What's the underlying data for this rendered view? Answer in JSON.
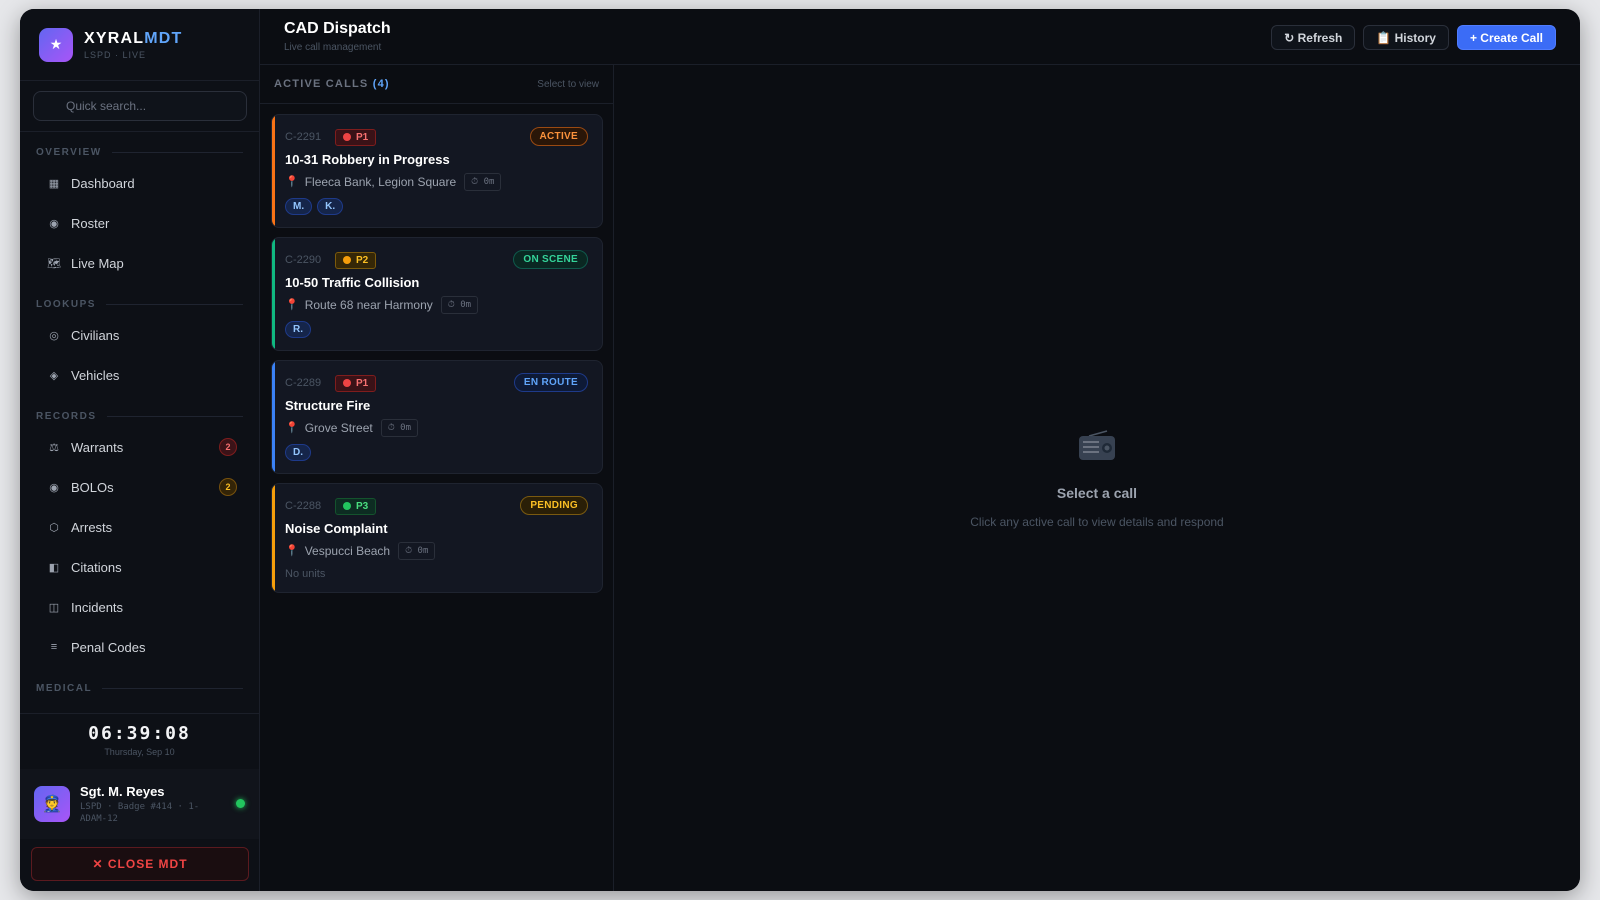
{
  "brand": {
    "name_part1": "XYRAL",
    "name_part2": "MDT",
    "sub": "LSPD · LIVE",
    "logo_icon": "star-icon"
  },
  "search": {
    "placeholder": "Quick search..."
  },
  "sidebar": {
    "sections": [
      {
        "title": "OVERVIEW",
        "items": [
          {
            "label": "Dashboard",
            "icon": "grid-icon"
          },
          {
            "label": "Roster",
            "icon": "target-icon"
          },
          {
            "label": "Live Map",
            "icon": "map-icon"
          }
        ]
      },
      {
        "title": "LOOKUPS",
        "items": [
          {
            "label": "Civilians",
            "icon": "person-icon"
          },
          {
            "label": "Vehicles",
            "icon": "diamond-icon"
          }
        ]
      },
      {
        "title": "RECORDS",
        "items": [
          {
            "label": "Warrants",
            "icon": "scale-icon",
            "badge": "2"
          },
          {
            "label": "BOLOs",
            "icon": "target-icon",
            "badge": "2"
          },
          {
            "label": "Arrests",
            "icon": "hexagon-icon"
          },
          {
            "label": "Citations",
            "icon": "ticket-icon"
          },
          {
            "label": "Incidents",
            "icon": "file-icon"
          },
          {
            "label": "Penal Codes",
            "icon": "list-icon"
          }
        ]
      },
      {
        "title": "MEDICAL",
        "items": []
      }
    ]
  },
  "clock": {
    "time": "06:39:08",
    "date": "Thursday, Sep 10"
  },
  "user": {
    "name": "Sgt. M. Reyes",
    "meta": "LSPD · Badge #414 · 1-ADAM-12",
    "status_color": "#22c55e"
  },
  "close_button": {
    "label": "✕ CLOSE MDT"
  },
  "header": {
    "title": "CAD Dispatch",
    "subtitle": "Live call management",
    "refresh": "↻ Refresh",
    "history": "📋 History",
    "create": "+ Create Call"
  },
  "calls": {
    "title": "ACTIVE CALLS",
    "count": "(4)",
    "hint": "Select to view",
    "items": [
      {
        "id": "C-2291",
        "priority": "P1",
        "status": "ACTIVE",
        "title": "10-31 Robbery in Progress",
        "location": "Fleeca Bank, Legion Square",
        "timer": "⏱ 0m",
        "units": [
          "M.",
          "K."
        ],
        "stripe": "#f97316"
      },
      {
        "id": "C-2290",
        "priority": "P2",
        "status": "ON SCENE",
        "title": "10-50 Traffic Collision",
        "location": "Route 68 near Harmony",
        "timer": "⏱ 0m",
        "units": [
          "R."
        ],
        "stripe": "#10b981"
      },
      {
        "id": "C-2289",
        "priority": "P1",
        "status": "EN ROUTE",
        "title": "Structure Fire",
        "location": "Grove Street",
        "timer": "⏱ 0m",
        "units": [
          "D."
        ],
        "stripe": "#3b82f6"
      },
      {
        "id": "C-2288",
        "priority": "P3",
        "status": "PENDING",
        "title": "Noise Complaint",
        "location": "Vespucci Beach",
        "timer": "⏱ 0m",
        "units": [],
        "no_units": "No units",
        "stripe": "#f59e0b"
      }
    ]
  },
  "detail": {
    "title": "Select a call",
    "subtitle": "Click any active call to view details and respond",
    "icon": "radio-icon"
  }
}
